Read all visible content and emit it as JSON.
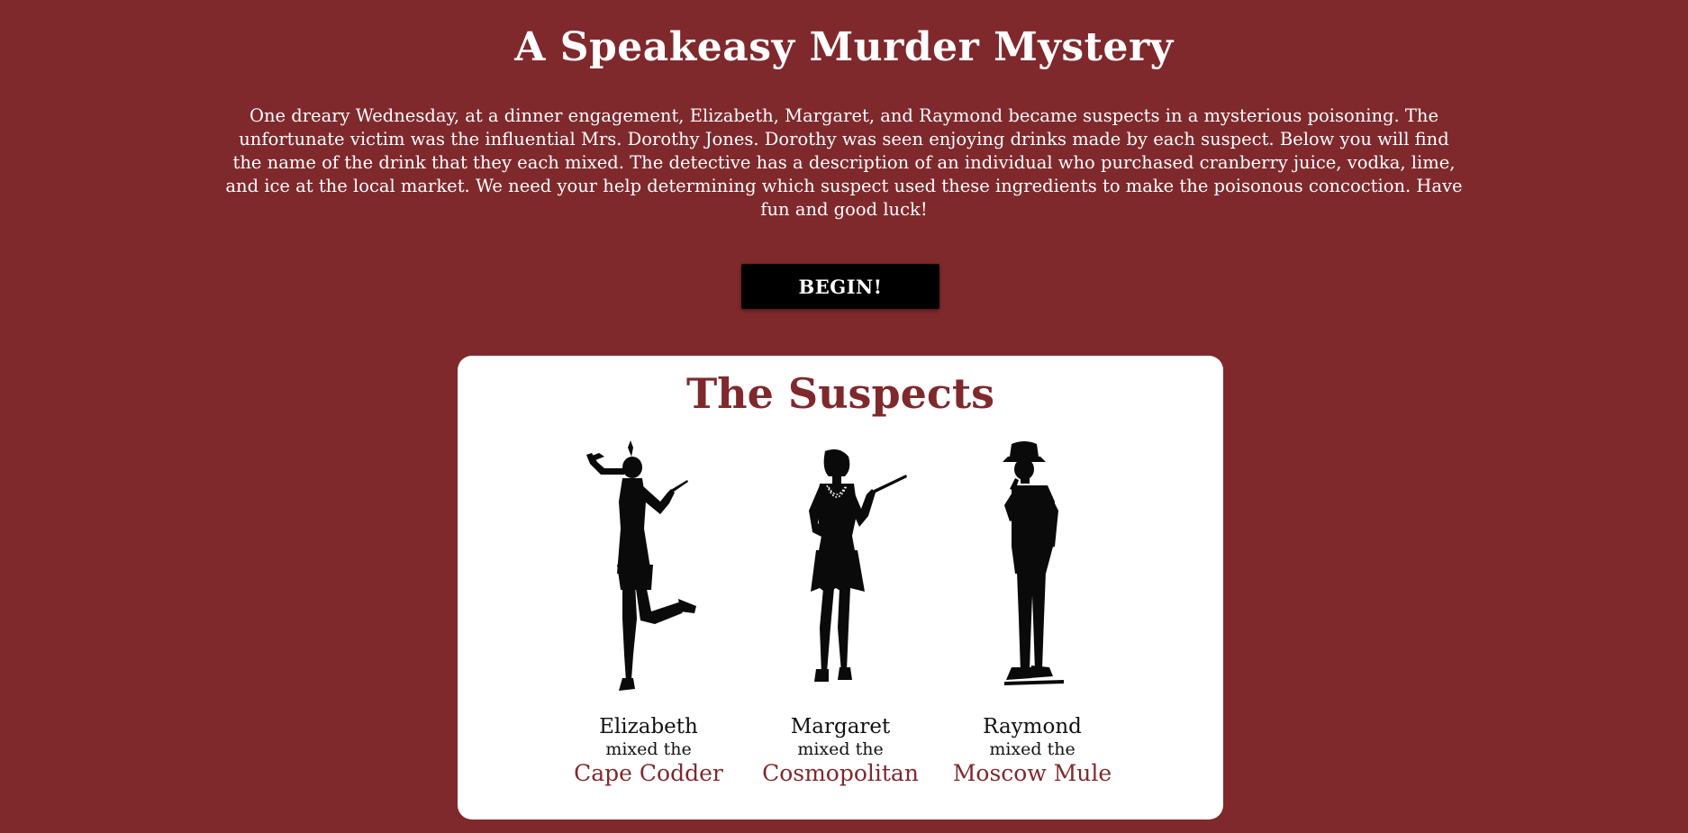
{
  "header": {
    "title": "A Speakeasy Murder Mystery",
    "intro": "One dreary Wednesday, at a dinner engagement, Elizabeth, Margaret, and Raymond became suspects in a mysterious poisoning. The unfortunate victim was the influential Mrs. Dorothy Jones. Dorothy was seen enjoying drinks made by each suspect. Below you will find the name of the drink that they each mixed. The detective has a description of an individual who purchased cranberry juice, vodka, lime, and ice at the local market. We need your help determining which suspect used these ingredients to make the poisonous concoction. Have fun and good luck!"
  },
  "begin_button": {
    "label": "BEGIN!"
  },
  "suspects": {
    "heading": "The Suspects",
    "items": [
      {
        "name": "Elizabeth",
        "mixed": "mixed the",
        "drink": "Cape Codder",
        "icon": "flapper-dancing-silhouette-icon"
      },
      {
        "name": "Margaret",
        "mixed": "mixed the",
        "drink": "Cosmopolitan",
        "icon": "flapper-standing-silhouette-icon"
      },
      {
        "name": "Raymond",
        "mixed": "mixed the",
        "drink": "Moscow Mule",
        "icon": "gentleman-fedora-silhouette-icon"
      }
    ]
  },
  "colors": {
    "background": "#7f292d",
    "card": "#ffffff",
    "accent": "#7f292d",
    "button": "#000000"
  }
}
